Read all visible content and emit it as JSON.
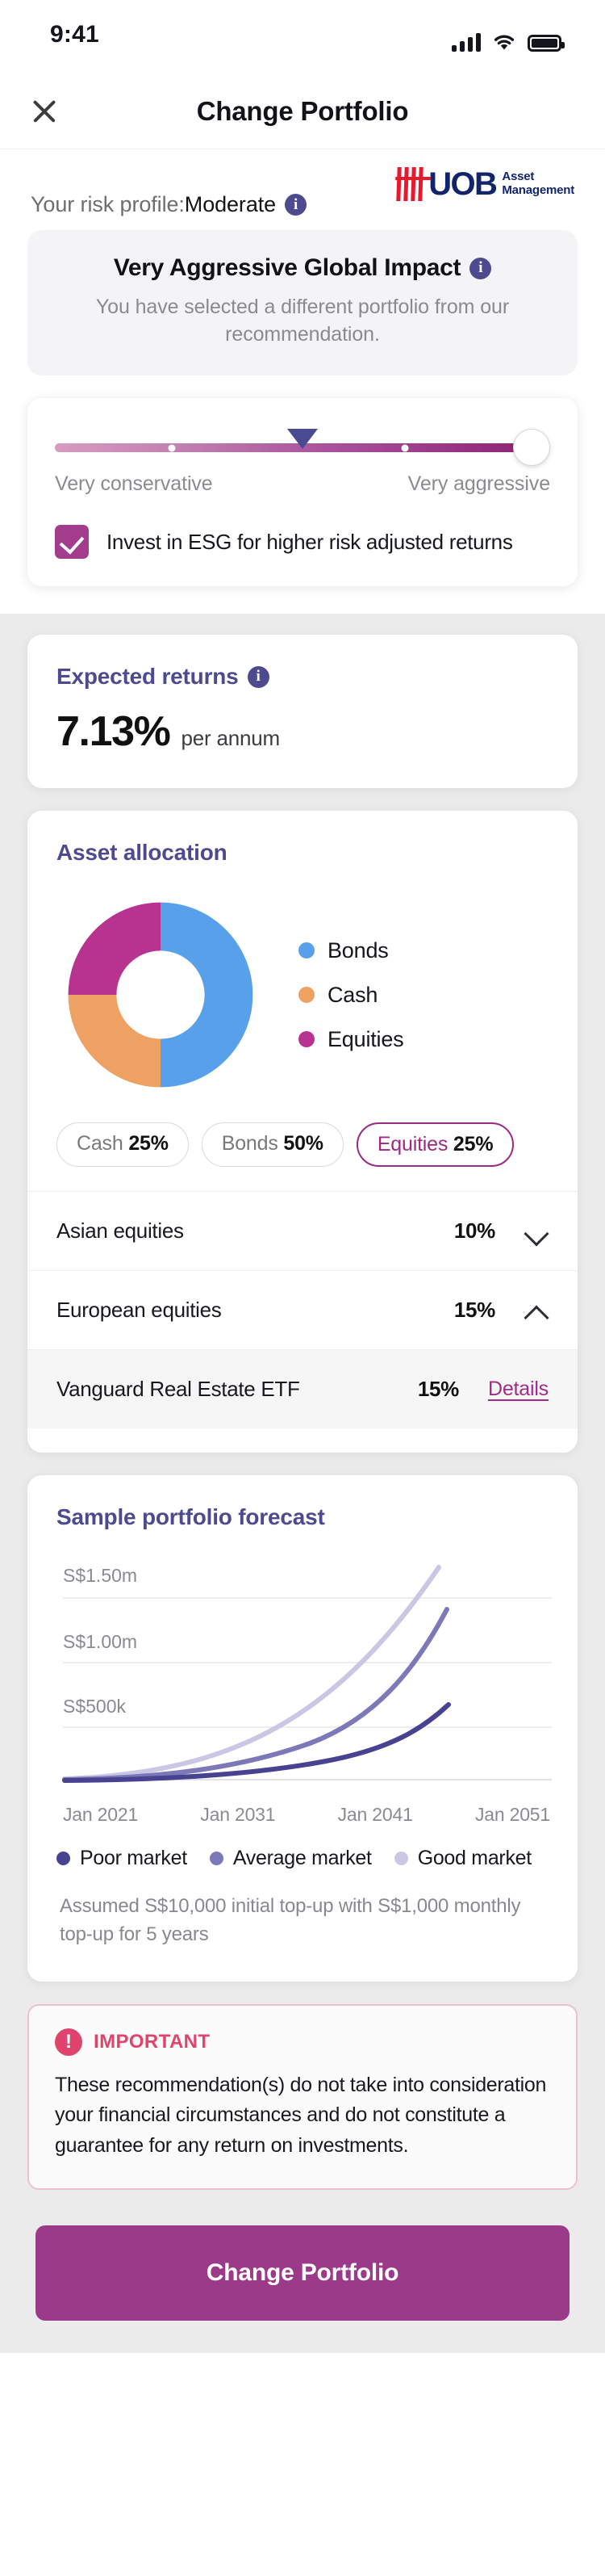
{
  "status_bar": {
    "time": "9:41",
    "signal_icon": "cellular-signal-icon",
    "wifi_icon": "wifi-icon",
    "battery_icon": "battery-icon"
  },
  "header": {
    "title": "Change Portfolio",
    "close_icon": "close-icon"
  },
  "profile": {
    "label": "Your risk profile: ",
    "value": "Moderate",
    "info_icon": "info-icon",
    "logo": {
      "word": "UOB",
      "line1": "Asset",
      "line2": "Management",
      "bars_icon": "uob-bars-icon"
    }
  },
  "portfolio_banner": {
    "title": "Very Aggressive Global Impact",
    "info_icon": "info-icon",
    "subtitle": "You have selected a different portfolio from our recommendation."
  },
  "risk_slider": {
    "min_label": "Very conservative",
    "max_label": "Very aggressive",
    "recommended_marker_pct": 50,
    "selected_pct": 100,
    "tick_pcts": [
      25,
      75
    ],
    "marker_icon": "recommended-marker-icon",
    "thumb_icon": "slider-thumb-icon"
  },
  "esg": {
    "checked": true,
    "label": "Invest in ESG for higher risk adjusted returns",
    "check_icon": "checkmark-icon"
  },
  "expected_returns": {
    "title": "Expected returns",
    "info_icon": "info-icon",
    "value": "7.13%",
    "unit": "per annum"
  },
  "asset_allocation": {
    "title": "Asset allocation",
    "legend": [
      {
        "label": "Bonds",
        "color": "#58a1ea"
      },
      {
        "label": "Cash",
        "color": "#eda264"
      },
      {
        "label": "Equities",
        "color": "#b8338f"
      }
    ],
    "chips": [
      {
        "name": "Cash",
        "pct": "25%",
        "active": false
      },
      {
        "name": "Bonds",
        "pct": "50%",
        "active": false
      },
      {
        "name": "Equities",
        "pct": "25%",
        "active": true
      }
    ],
    "holdings": [
      {
        "name": "Asian equities",
        "pct": "10%",
        "action": "chevron-down-icon"
      },
      {
        "name": "European equities",
        "pct": "15%",
        "action": "chevron-up-icon"
      },
      {
        "name": "Vanguard Real Estate ETF",
        "pct": "15%",
        "action": "Details",
        "sub": true
      }
    ]
  },
  "forecast": {
    "title": "Sample portfolio forecast",
    "legend": [
      {
        "label": "Poor market",
        "color": "#474391"
      },
      {
        "label": "Average market",
        "color": "#7d79b8"
      },
      {
        "label": "Good market",
        "color": "#c9c7e4"
      }
    ],
    "assumption": "Assumed S$10,000 initial top-up with S$1,000 monthly top-up for 5 years"
  },
  "important": {
    "icon": "alert-icon",
    "badge": "IMPORTANT",
    "body": "These recommendation(s) do not take into consideration your financial circumstances and do not constitute a guarantee for any return on investments."
  },
  "cta": {
    "label": "Change Portfolio"
  },
  "chart_data": [
    {
      "type": "pie",
      "title": "Asset allocation",
      "categories": [
        "Bonds",
        "Cash",
        "Equities"
      ],
      "values": [
        50,
        25,
        25
      ],
      "colors": [
        "#58a1ea",
        "#eda264",
        "#b8338f"
      ],
      "donut": true,
      "inner_radius_ratio": 0.58,
      "start_angle_deg": 0,
      "legend_position": "right",
      "units": "%"
    },
    {
      "type": "line",
      "title": "Sample portfolio forecast",
      "x": [
        "Jan 2021",
        "Jan 2031",
        "Jan 2041",
        "Jan 2051"
      ],
      "xlabel": "",
      "ylabel": "",
      "ytick_labels": [
        "S$500k",
        "S$1.00m",
        "S$1.50m"
      ],
      "ytick_values": [
        500000,
        1000000,
        1500000
      ],
      "ylim": [
        0,
        1750000
      ],
      "grid": true,
      "legend_position": "bottom",
      "series": [
        {
          "name": "Poor market",
          "color": "#474391",
          "values": [
            10000,
            120000,
            300000,
            620000
          ]
        },
        {
          "name": "Average market",
          "color": "#7d79b8",
          "values": [
            10000,
            185000,
            560000,
            1190000
          ]
        },
        {
          "name": "Good market",
          "color": "#c9c7e4",
          "values": [
            10000,
            260000,
            840000,
            1640000
          ]
        }
      ]
    }
  ]
}
